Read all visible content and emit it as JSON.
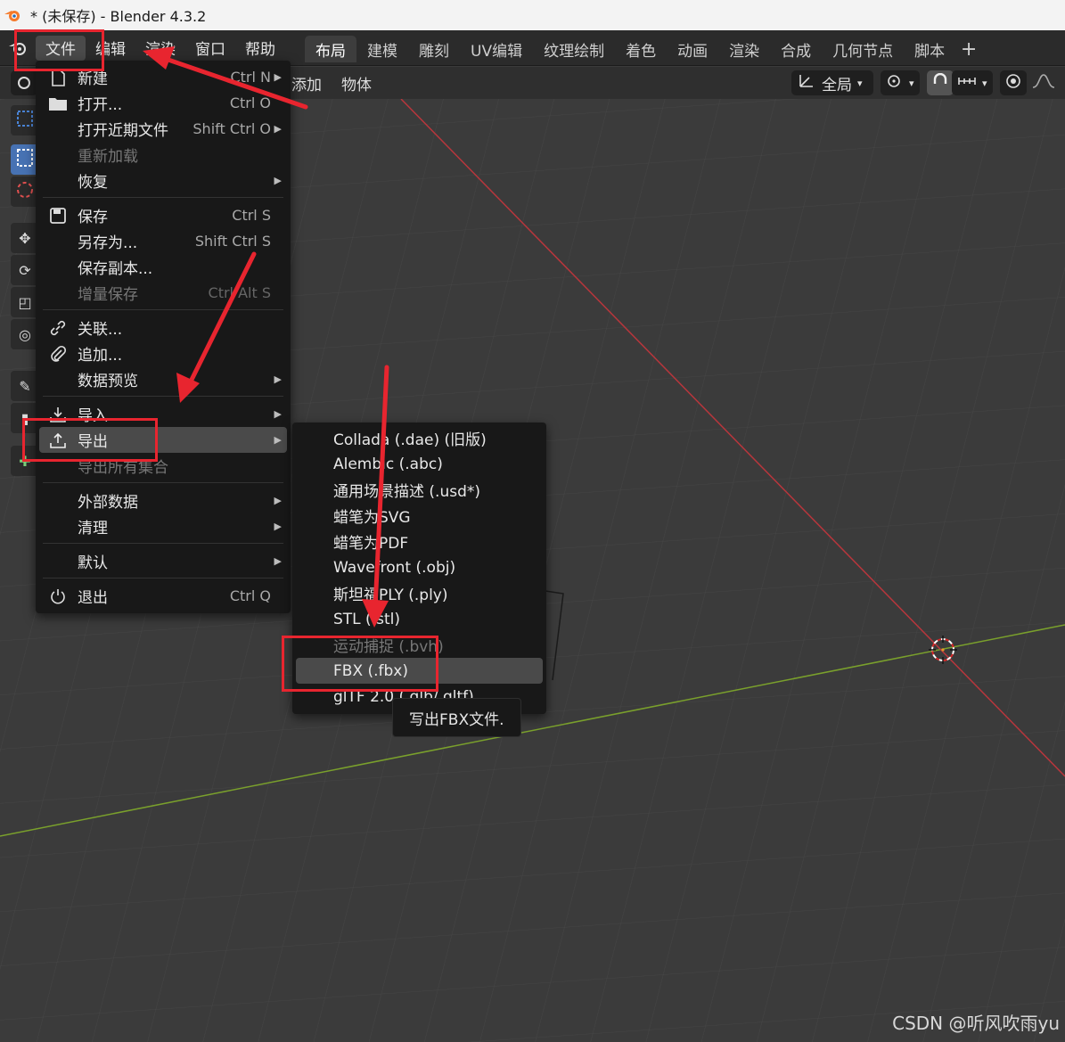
{
  "window": {
    "title": "* (未保存) - Blender 4.3.2"
  },
  "menubar": {
    "items": [
      "文件",
      "编辑",
      "渲染",
      "窗口",
      "帮助"
    ]
  },
  "workspaces": {
    "tabs": [
      "布局",
      "建模",
      "雕刻",
      "UV编辑",
      "纹理绘制",
      "着色",
      "动画",
      "渲染",
      "合成",
      "几何节点",
      "脚本"
    ],
    "add": "+"
  },
  "viewport_header": {
    "add_label": "添加",
    "object_label": "物体",
    "transform_orient": "全局"
  },
  "file_menu": {
    "new": {
      "label": "新建",
      "shortcut": "Ctrl N"
    },
    "open": {
      "label": "打开...",
      "shortcut": "Ctrl O"
    },
    "open_recent": {
      "label": "打开近期文件",
      "shortcut": "Shift Ctrl O"
    },
    "revert": {
      "label": "重新加载"
    },
    "recover": {
      "label": "恢复"
    },
    "save": {
      "label": "保存",
      "shortcut": "Ctrl S"
    },
    "save_as": {
      "label": "另存为...",
      "shortcut": "Shift Ctrl S"
    },
    "save_copy": {
      "label": "保存副本..."
    },
    "save_increment": {
      "label": "增量保存",
      "shortcut": "Ctrl Alt S"
    },
    "link": {
      "label": "关联..."
    },
    "append": {
      "label": "追加..."
    },
    "data_previews": {
      "label": "数据预览"
    },
    "import": {
      "label": "导入"
    },
    "export": {
      "label": "导出"
    },
    "export_all_collections": {
      "label": "导出所有集合"
    },
    "external_data": {
      "label": "外部数据"
    },
    "cleanup": {
      "label": "清理"
    },
    "defaults": {
      "label": "默认"
    },
    "quit": {
      "label": "退出",
      "shortcut": "Ctrl Q"
    }
  },
  "export_menu": {
    "items": [
      "Collada (.dae) (旧版)",
      "Alembic (.abc)",
      "通用场景描述 (.usd*)",
      "蜡笔为SVG",
      "蜡笔为PDF",
      "Wavefront (.obj)",
      "斯坦福PLY (.ply)",
      "STL (.stl)",
      "运动捕捉 (.bvh)",
      "FBX (.fbx)",
      "glTF 2.0 (.glb/.gltf)"
    ]
  },
  "tooltip": {
    "text": "写出FBX文件."
  },
  "watermark": {
    "text": "CSDN @听风吹雨yu"
  },
  "colors": {
    "annotation_red": "#e8252f",
    "x_axis": "#b8363c",
    "y_axis": "#7aa02c",
    "highlight": "#4a4a4a",
    "active_tool": "#4772b3"
  }
}
